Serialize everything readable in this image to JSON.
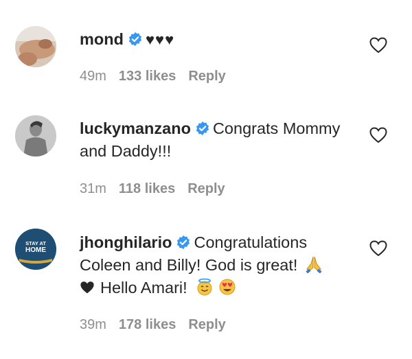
{
  "comments": [
    {
      "username": "mond",
      "text": "♥♥♥",
      "time": "49m",
      "likes": "133 likes",
      "reply": "Reply",
      "avatar_icon": "user-photo-avatar"
    },
    {
      "username": "luckymanzano",
      "text": "Congrats Mommy and Daddy!!!",
      "time": "31m",
      "likes": "118 likes",
      "reply": "Reply",
      "avatar_icon": "user-photo-avatar"
    },
    {
      "username": "jhonghilario",
      "text_line1": "Congratulations",
      "text_line2": "Coleen and Billy! God is great!",
      "text_line3": "Hello Amari!",
      "time": "39m",
      "likes": "178 likes",
      "reply": "Reply",
      "avatar_text_1": "STAY AT",
      "avatar_text_2": "HOME"
    }
  ],
  "colors": {
    "verified_blue": "#3897f0",
    "meta_gray": "#8e8e8e",
    "text": "#262626",
    "avatar_navy": "#1e4e73"
  }
}
